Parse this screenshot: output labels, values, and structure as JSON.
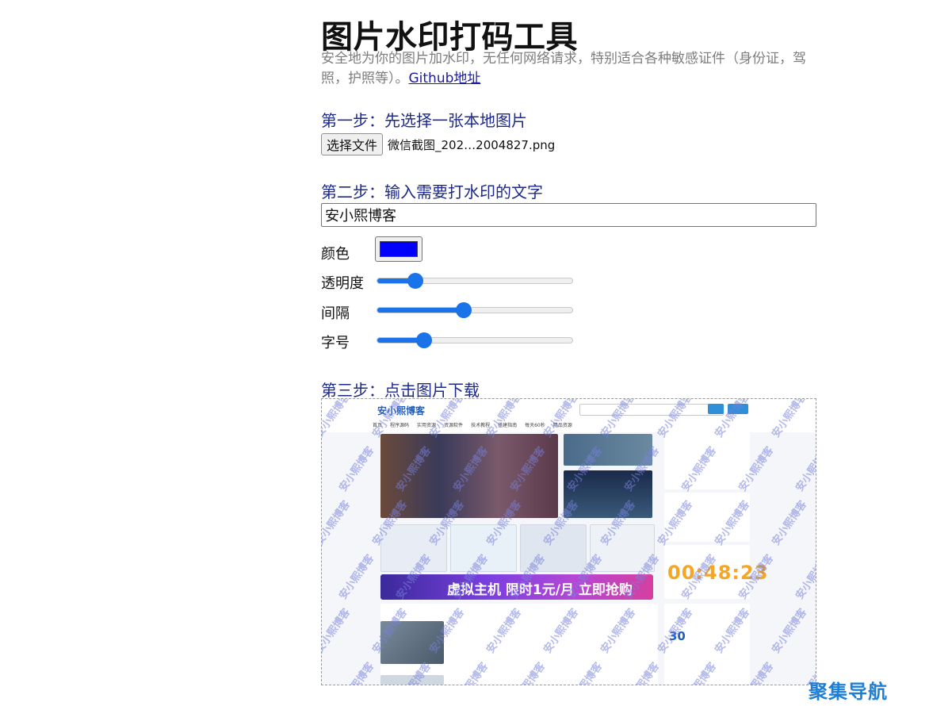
{
  "header": {
    "title": "图片水印打码工具",
    "subtitle": "安全地为你的图片加水印，无任何网络请求，特别适合各种敏感证件（身份证，驾照，护照等）。",
    "github_link": "Github地址"
  },
  "step1": {
    "title": "第一步：先选择一张本地图片",
    "file_button": "选择文件",
    "file_name": "微信截图_202…2004827.png"
  },
  "step2": {
    "title": "第二步：输入需要打水印的文字",
    "watermark_text": "安小熙博客",
    "color_label": "颜色",
    "color_value": "#0000ff",
    "opacity_label": "透明度",
    "opacity_fraction": 0.17,
    "spacing_label": "间隔",
    "spacing_fraction": 0.44,
    "fontsize_label": "字号",
    "fontsize_fraction": 0.22
  },
  "step3": {
    "title": "第三步：点击图片下载",
    "preview": {
      "watermark": "安小熙博客",
      "site_logo": "安小熙博客",
      "nav": [
        "首页",
        "程序源码",
        "实用资源",
        "资源软件",
        "技术教程",
        "搭建指南",
        "每天60秒",
        "精品资源"
      ],
      "banner_text": "虚拟主机 限时1元/月 立即抢购",
      "clock_text": "00:48:23",
      "weather_temp": "30"
    }
  },
  "brand": {
    "text": "聚集导航"
  }
}
